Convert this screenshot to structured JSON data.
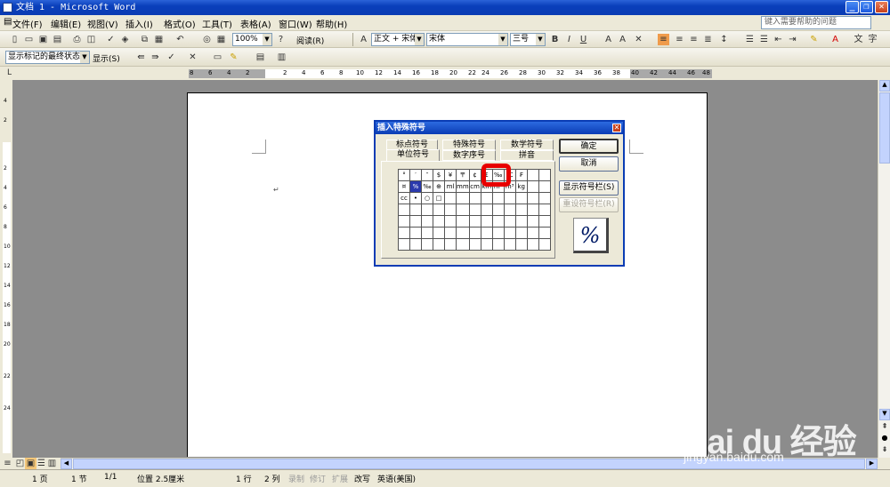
{
  "window": {
    "title": "文档 1 - Microsoft Word"
  },
  "menu": {
    "items": [
      "文件(F)",
      "编辑(E)",
      "视图(V)",
      "插入(I)",
      "格式(O)",
      "工具(T)",
      "表格(A)",
      "窗口(W)",
      "帮助(H)"
    ],
    "help_placeholder": "键入需要帮助的问题"
  },
  "standard_toolbar": {
    "zoom": "100%",
    "read_label": "阅读(R)"
  },
  "format_toolbar": {
    "style": "正文 + 宋体",
    "font": "宋体",
    "size": "三号"
  },
  "review_toolbar": {
    "display_mode": "显示标记的最终状态",
    "show_label": "显示(S)"
  },
  "ruler": {
    "h_ticks": [
      "8",
      "6",
      "4",
      "2",
      "2",
      "4",
      "6",
      "8",
      "10",
      "12",
      "14",
      "16",
      "18",
      "20",
      "22",
      "24",
      "26",
      "28",
      "30",
      "32",
      "34",
      "36",
      "38",
      "40",
      "42",
      "44",
      "46",
      "48"
    ],
    "v_ticks": [
      "4",
      "2",
      "2",
      "4",
      "6",
      "8",
      "10",
      "12",
      "14",
      "16",
      "18",
      "20",
      "22",
      "24"
    ]
  },
  "document": {
    "paragraph_mark": "↵"
  },
  "dialog": {
    "title": "插入特殊符号",
    "tabs_row1": [
      "标点符号",
      "特殊符号",
      "数学符号"
    ],
    "tabs_row2": [
      "单位符号",
      "数字序号",
      "拼音"
    ],
    "grid": [
      [
        "°",
        "′",
        "″",
        "$",
        "¥",
        "〒",
        "¢",
        "£",
        "‰",
        "℃",
        "₣",
        "",
        ""
      ],
      [
        "¤",
        "%",
        "‰",
        "⊕",
        "ml",
        "mm",
        "cm",
        "km",
        "m²",
        "m³",
        "kg",
        "",
        ""
      ],
      [
        "cc",
        "•",
        "○",
        "□",
        "",
        "",
        "",
        "",
        "",
        "",
        "",
        "",
        ""
      ],
      [
        "",
        "",
        "",
        "",
        "",
        "",
        "",
        "",
        "",
        "",
        "",
        "",
        ""
      ],
      [
        "",
        "",
        "",
        "",
        "",
        "",
        "",
        "",
        "",
        "",
        "",
        "",
        ""
      ],
      [
        "",
        "",
        "",
        "",
        "",
        "",
        "",
        "",
        "",
        "",
        "",
        "",
        ""
      ],
      [
        "",
        "",
        "",
        "",
        "",
        "",
        "",
        "",
        "",
        "",
        "",
        "",
        ""
      ]
    ],
    "ok_label": "确定",
    "cancel_label": "取消",
    "show_bar_label": "显示符号栏(S)",
    "reset_bar_label": "重设符号栏(R)",
    "preview": "%"
  },
  "statusbar": {
    "page": "1 页",
    "section": "1 节",
    "pages": "1/1",
    "position": "位置 2.5厘米",
    "line": "1 行",
    "column": "2 列",
    "rec": "录制",
    "trk": "修订",
    "ext": "扩展",
    "ovr": "改写",
    "lang": "英语(美国)"
  },
  "watermark": {
    "logo": "Bai du 经验",
    "url": "jingyan.baidu.com"
  }
}
